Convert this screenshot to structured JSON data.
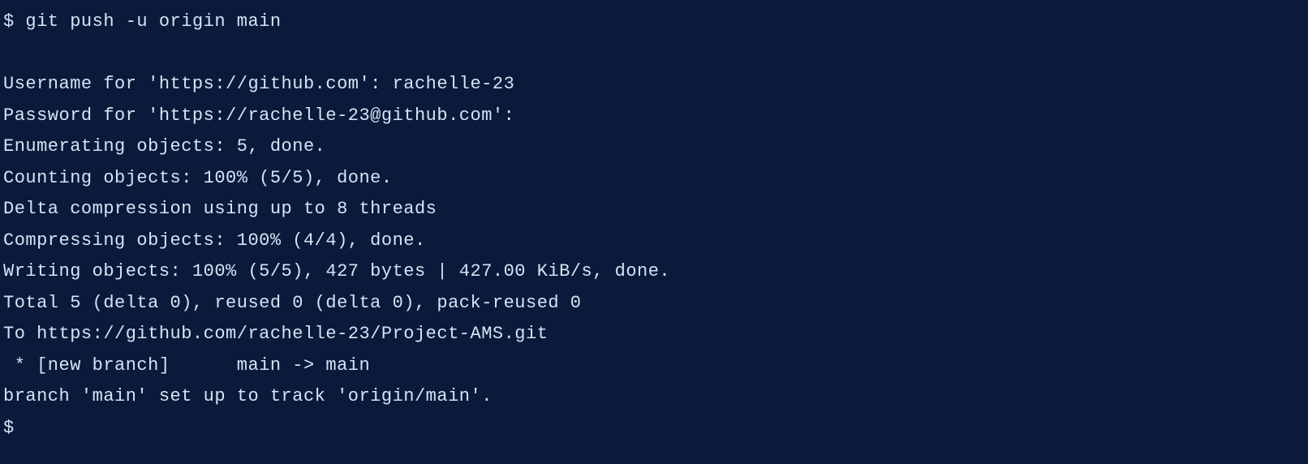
{
  "terminal": {
    "prompt_symbol": "$",
    "command": "git push -u origin main",
    "blank_line": "",
    "username_prompt": "Username for 'https://github.com': rachelle-23",
    "password_prompt": "Password for 'https://rachelle-23@github.com':",
    "enumerating": "Enumerating objects: 5, done.",
    "counting": "Counting objects: 100% (5/5), done.",
    "delta_compression": "Delta compression using up to 8 threads",
    "compressing": "Compressing objects: 100% (4/4), done.",
    "writing": "Writing objects: 100% (5/5), 427 bytes | 427.00 KiB/s, done.",
    "total": "Total 5 (delta 0), reused 0 (delta 0), pack-reused 0",
    "to_remote": "To https://github.com/rachelle-23/Project-AMS.git",
    "new_branch": " * [new branch]      main -> main",
    "tracking": "branch 'main' set up to track 'origin/main'.",
    "final_prompt": "$"
  }
}
